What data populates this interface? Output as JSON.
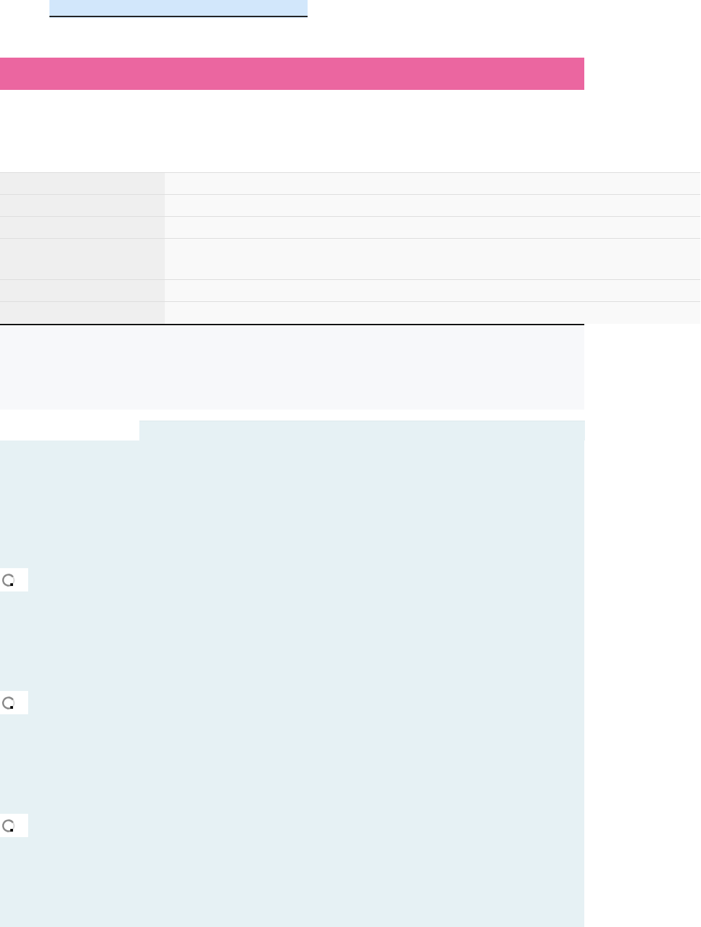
{
  "table": {
    "rows": [
      {
        "kind": "single"
      },
      {
        "kind": "single"
      },
      {
        "kind": "single"
      },
      {
        "kind": "double"
      },
      {
        "kind": "single"
      },
      {
        "kind": "single"
      }
    ]
  },
  "content_panel": {
    "items": [
      {
        "kind": "spinner"
      },
      {
        "kind": "spinner"
      },
      {
        "kind": "spinner"
      }
    ]
  }
}
